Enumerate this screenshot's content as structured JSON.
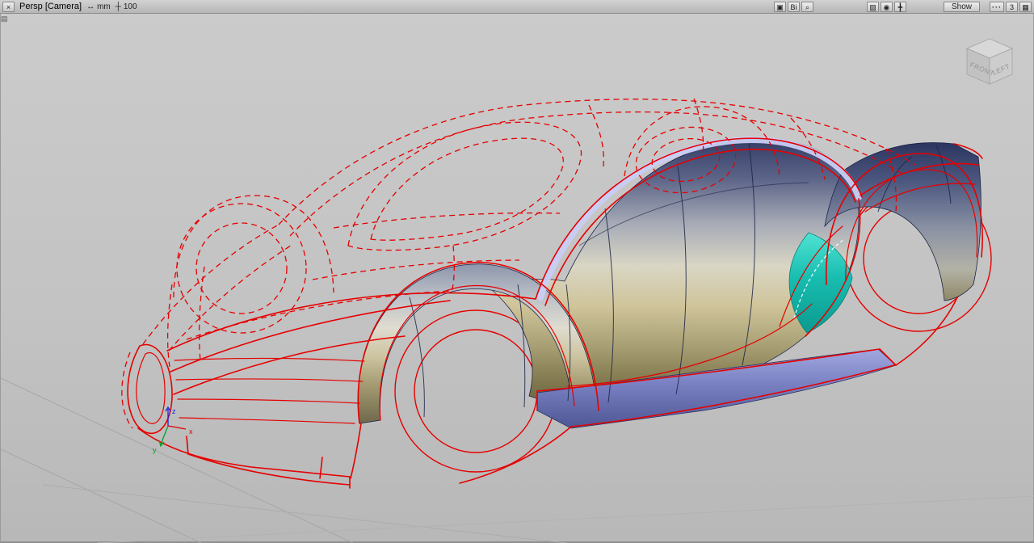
{
  "titlebar": {
    "close_glyph": "×",
    "view_name": "Persp",
    "camera_label": "[Camera]",
    "resize_glyph": "↔",
    "units": "mm",
    "snap_glyph": "┼",
    "grid_value": "100",
    "display_icons": {
      "display": "▣",
      "bi": "Bi",
      "magnify": "⌕"
    },
    "tool_icons": {
      "shade": "▧",
      "orbit": "◉",
      "pan": "╋"
    },
    "show_button": "Show",
    "detail_glyph": "···",
    "panel_count": "3",
    "layout_glyph": "▦"
  },
  "viewport": {
    "corner_glyph": "▤",
    "viewcube": {
      "front": "FRONT",
      "left": "LEFT"
    },
    "axes": {
      "x": "x",
      "y": "y",
      "z": "z"
    },
    "colors": {
      "wireframe_red": "#e60000",
      "section_navy": "#1c2448",
      "surface_steel_top": "#38406a",
      "surface_khaki_bottom": "#6e6848",
      "surface_teal": "#14b8aa",
      "sill_blue": "#7880c2",
      "roof_band_lavender": "#c9cdf4",
      "background_gray": "#c4c4c4"
    }
  }
}
